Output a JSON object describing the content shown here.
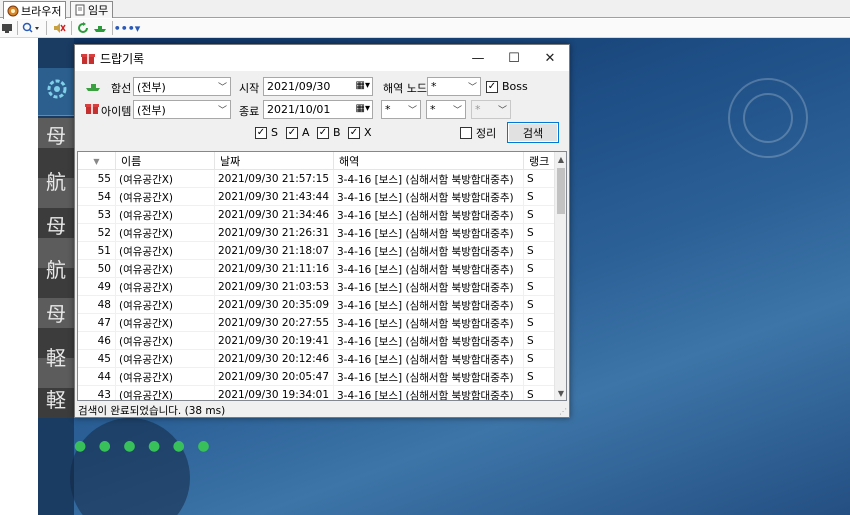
{
  "tabs": [
    {
      "label": "브라우저",
      "active": true,
      "icon": "browser-icon"
    },
    {
      "label": "임무",
      "active": false,
      "icon": "document-icon"
    }
  ],
  "toolbar": {
    "items": [
      "screen-icon",
      "zoom-icon",
      "mute-icon",
      "refresh-icon",
      "ship-icon",
      "more-icon"
    ]
  },
  "dialog": {
    "title": "드랍기록",
    "ship_label": "함선",
    "ship_value": "(전부)",
    "item_label": "아이템",
    "item_value": "(전부)",
    "start_label": "시작",
    "start_value": "2021/09/30",
    "end_label": "종료",
    "end_value": "2021/10/01",
    "node_label": "해역 노드",
    "node_value": "*",
    "boss_label": "Boss",
    "boss_checked": true,
    "area_values": [
      "*",
      "*",
      "*"
    ],
    "rank_s": "S",
    "rank_a": "A",
    "rank_b": "B",
    "rank_x": "X",
    "arrange_label": "정리",
    "search_label": "검색",
    "status": "검색이 완료되었습니다. (38 ms)"
  },
  "grid": {
    "columns": [
      "",
      "이름",
      "날짜",
      "해역",
      "랭크"
    ],
    "rows": [
      {
        "no": "55",
        "name": "(여유공간X)",
        "date": "2021/09/30 21:57:15",
        "area": "3-4-16 [보스] (심해서함 북방함대중추)",
        "rank": "S"
      },
      {
        "no": "54",
        "name": "(여유공간X)",
        "date": "2021/09/30 21:43:44",
        "area": "3-4-16 [보스] (심해서함 북방함대중추)",
        "rank": "S"
      },
      {
        "no": "53",
        "name": "(여유공간X)",
        "date": "2021/09/30 21:34:46",
        "area": "3-4-16 [보스] (심해서함 북방함대중추)",
        "rank": "S"
      },
      {
        "no": "52",
        "name": "(여유공간X)",
        "date": "2021/09/30 21:26:31",
        "area": "3-4-16 [보스] (심해서함 북방함대중추)",
        "rank": "S"
      },
      {
        "no": "51",
        "name": "(여유공간X)",
        "date": "2021/09/30 21:18:07",
        "area": "3-4-16 [보스] (심해서함 북방함대중추)",
        "rank": "S"
      },
      {
        "no": "50",
        "name": "(여유공간X)",
        "date": "2021/09/30 21:11:16",
        "area": "3-4-16 [보스] (심해서함 북방함대중추)",
        "rank": "S"
      },
      {
        "no": "49",
        "name": "(여유공간X)",
        "date": "2021/09/30 21:03:53",
        "area": "3-4-16 [보스] (심해서함 북방함대중추)",
        "rank": "S"
      },
      {
        "no": "48",
        "name": "(여유공간X)",
        "date": "2021/09/30 20:35:09",
        "area": "3-4-16 [보스] (심해서함 북방함대중추)",
        "rank": "S"
      },
      {
        "no": "47",
        "name": "(여유공간X)",
        "date": "2021/09/30 20:27:55",
        "area": "3-4-16 [보스] (심해서함 북방함대중추)",
        "rank": "S"
      },
      {
        "no": "46",
        "name": "(여유공간X)",
        "date": "2021/09/30 20:19:41",
        "area": "3-4-16 [보스] (심해서함 북방함대중추)",
        "rank": "S"
      },
      {
        "no": "45",
        "name": "(여유공간X)",
        "date": "2021/09/30 20:12:46",
        "area": "3-4-16 [보스] (심해서함 북방함대중추)",
        "rank": "S"
      },
      {
        "no": "44",
        "name": "(여유공간X)",
        "date": "2021/09/30 20:05:47",
        "area": "3-4-16 [보스] (심해서함 북방함대중추)",
        "rank": "S"
      },
      {
        "no": "43",
        "name": "(여유공간X)",
        "date": "2021/09/30 19:34:01",
        "area": "3-4-16 [보스] (심해서함 북방함대중추)",
        "rank": "S"
      }
    ]
  },
  "game": {
    "kanji": [
      "母",
      "航",
      "母",
      "航",
      "母",
      "軽",
      "軽"
    ]
  },
  "colors": {
    "accent": "#0078d7",
    "dots": "#38c05a"
  }
}
